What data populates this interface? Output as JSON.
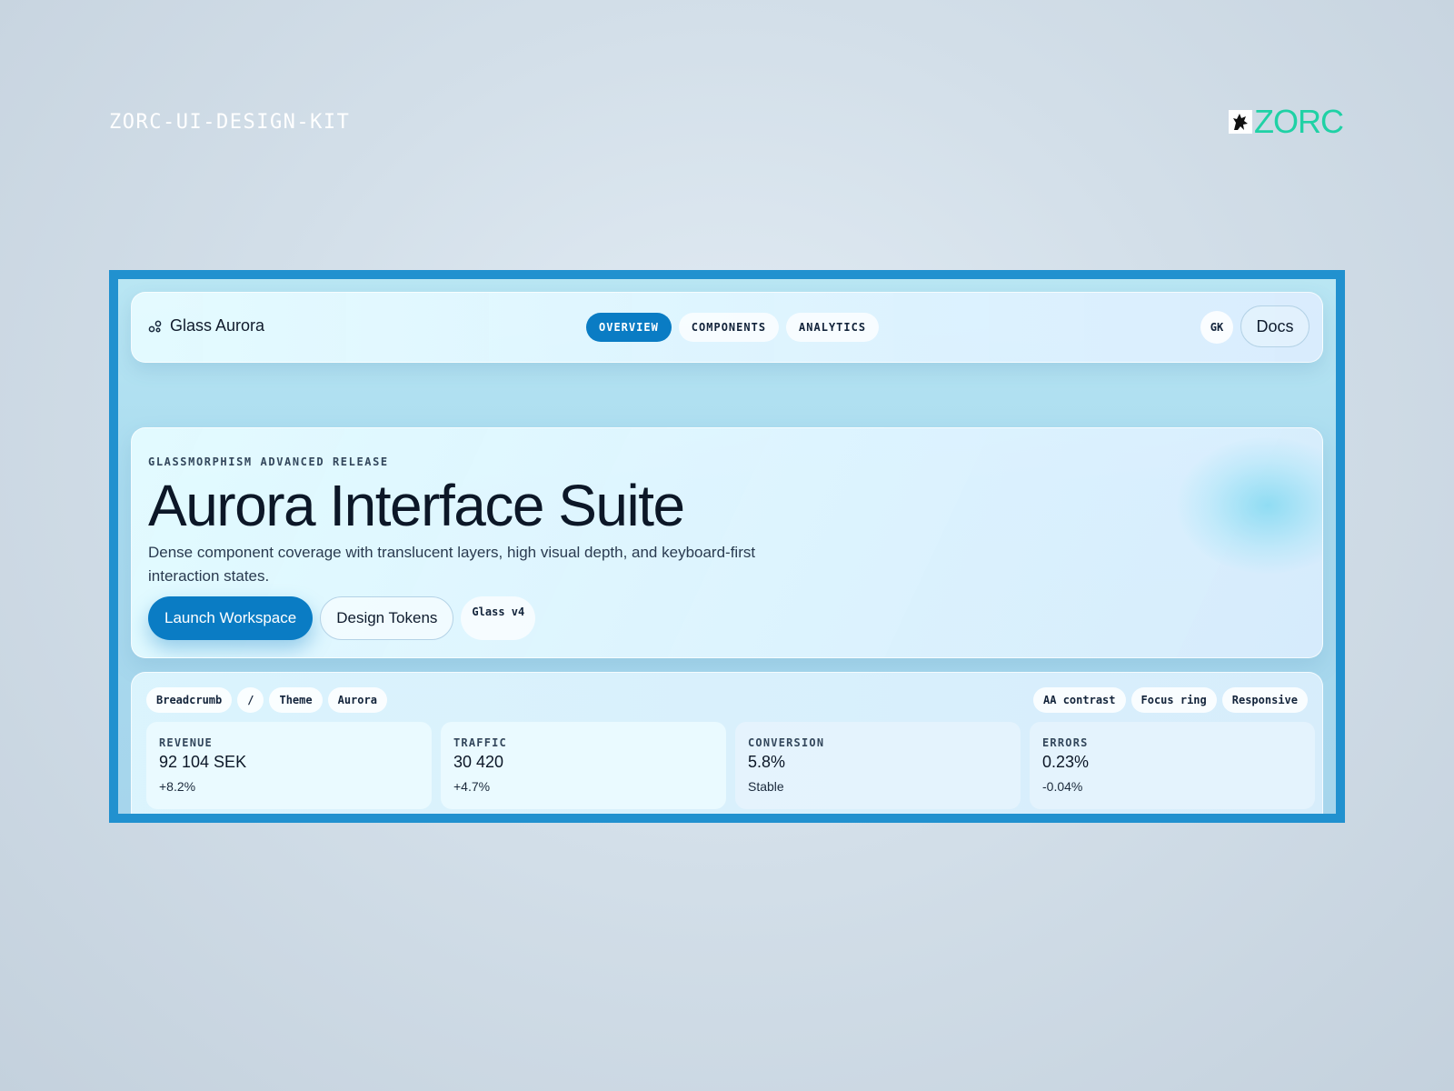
{
  "page": {
    "kit_label": "ZORC-UI-DESIGN-KIT",
    "brand": {
      "name": "ZORC",
      "icon": "wolf-logo-icon",
      "color": "#1fd1a5"
    }
  },
  "app": {
    "name": "Glass Aurora",
    "logo_icon": "nodes-icon",
    "nav": {
      "tabs": [
        {
          "label": "OVERVIEW",
          "active": true
        },
        {
          "label": "COMPONENTS",
          "active": false
        },
        {
          "label": "ANALYTICS",
          "active": false
        }
      ],
      "avatar_initials": "GK",
      "docs_label": "Docs"
    },
    "hero": {
      "eyebrow": "GLASSMORPHISM ADVANCED RELEASE",
      "title": "Aurora Interface Suite",
      "description": "Dense component coverage with translucent layers, high visual depth, and keyboard-first interaction states.",
      "primary_label": "Launch Workspace",
      "secondary_label": "Design Tokens",
      "version_chip": "Glass v4"
    },
    "breadcrumb": [
      "Breadcrumb",
      "/",
      "Theme",
      "Aurora"
    ],
    "badges": [
      "AA contrast",
      "Focus ring",
      "Responsive"
    ],
    "stats": [
      {
        "label": "REVENUE",
        "value": "92 104 SEK",
        "delta": "+8.2%"
      },
      {
        "label": "TRAFFIC",
        "value": "30 420",
        "delta": "+4.7%"
      },
      {
        "label": "CONVERSION",
        "value": "5.8%",
        "delta": "Stable"
      },
      {
        "label": "ERRORS",
        "value": "0.23%",
        "delta": "-0.04%"
      }
    ],
    "colors": {
      "accent": "#0a7cc4",
      "frame": "#2191cf"
    }
  }
}
